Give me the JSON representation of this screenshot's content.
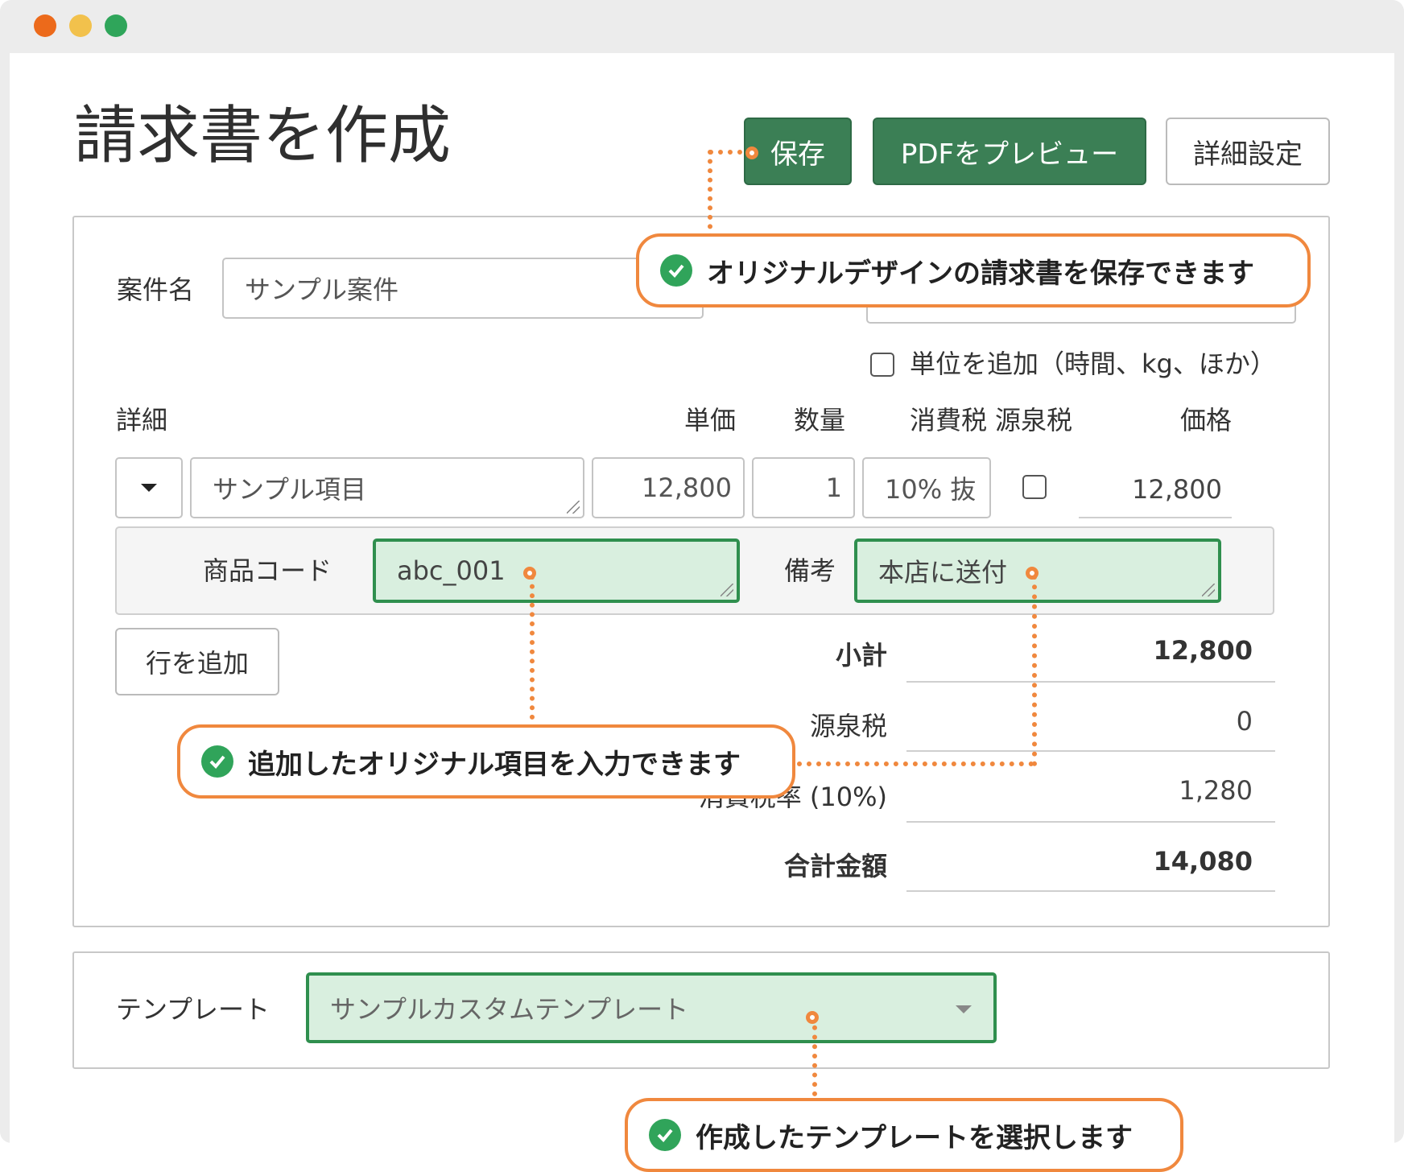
{
  "window": {
    "title": "請求書を作成",
    "traffic_lights": [
      "#ec6a1b",
      "#f2c14c",
      "#2fa55a"
    ]
  },
  "toolbar": {
    "save_label": "保存",
    "preview_label": "PDFをプレビュー",
    "settings_label": "詳細設定"
  },
  "project": {
    "label": "案件名",
    "value": "サンプル案件"
  },
  "unit_option": {
    "label": "単位を追加（時間、kg、ほか）",
    "checked": false
  },
  "table": {
    "headers": {
      "detail": "詳細",
      "unit_price": "単価",
      "quantity": "数量",
      "tax": "消費税",
      "withholding": "源泉税",
      "price": "価格"
    },
    "row": {
      "item": "サンプル項目",
      "unit_price": "12,800",
      "quantity": "1",
      "tax": "10% 抜",
      "withholding_checked": false,
      "price": "12,800"
    },
    "extra": {
      "code_label": "商品コード",
      "code_value": "abc_001",
      "note_label": "備考",
      "note_value": "本店に送付"
    },
    "add_row_label": "行を追加"
  },
  "totals": {
    "subtotal_label": "小計",
    "subtotal_value": "12,800",
    "withholding_label": "源泉税",
    "withholding_value": "0",
    "tax_label": "消費税率 (10%)",
    "tax_value": "1,280",
    "total_label": "合計金額",
    "total_value": "14,080"
  },
  "template": {
    "label": "テンプレート",
    "value": "サンプルカスタムテンプレート"
  },
  "callouts": {
    "save": "オリジナルデザインの請求書を保存できます",
    "fields": "追加したオリジナル項目を入力できます",
    "template": "作成したテンプレートを選択します"
  },
  "colors": {
    "accent_green": "#3b7f55",
    "field_green": "#d9efdf",
    "callout_orange": "#f0883e"
  }
}
